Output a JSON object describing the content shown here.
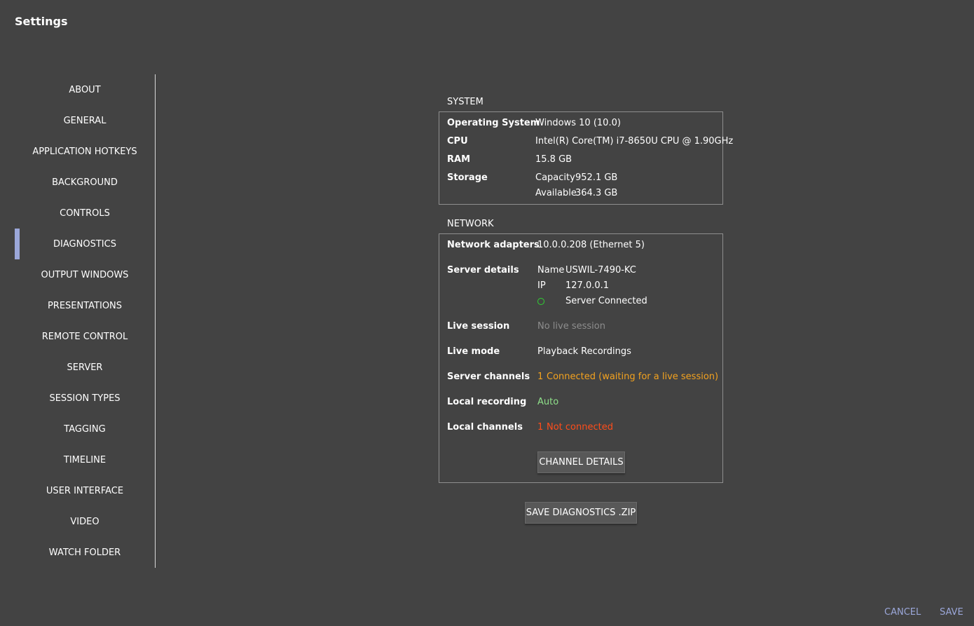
{
  "window": {
    "title": "Settings"
  },
  "sidebar": {
    "active_index": 5,
    "items": [
      {
        "label": "ABOUT"
      },
      {
        "label": "GENERAL"
      },
      {
        "label": "APPLICATION HOTKEYS"
      },
      {
        "label": "BACKGROUND"
      },
      {
        "label": "CONTROLS"
      },
      {
        "label": "DIAGNOSTICS"
      },
      {
        "label": "OUTPUT WINDOWS"
      },
      {
        "label": "PRESENTATIONS"
      },
      {
        "label": "REMOTE CONTROL"
      },
      {
        "label": "SERVER"
      },
      {
        "label": "SESSION TYPES"
      },
      {
        "label": "TAGGING"
      },
      {
        "label": "TIMELINE"
      },
      {
        "label": "USER INTERFACE"
      },
      {
        "label": "VIDEO"
      },
      {
        "label": "WATCH FOLDER"
      }
    ]
  },
  "system": {
    "heading": "SYSTEM",
    "os_label": "Operating System",
    "os_value": "Windows 10 (10.0)",
    "cpu_label": "CPU",
    "cpu_value": "Intel(R) Core(TM) i7-8650U CPU @ 1.90GHz",
    "ram_label": "RAM",
    "ram_value": "15.8 GB",
    "storage_label": "Storage",
    "capacity_label": "Capacity",
    "capacity_value": "952.1 GB",
    "available_label": "Available",
    "available_value": "364.3 GB"
  },
  "network": {
    "heading": "NETWORK",
    "adapters_label": "Network adapters",
    "adapters_value": "10.0.0.208 (Ethernet 5)",
    "server_details_label": "Server details",
    "name_label": "Name",
    "name_value": "USWIL-7490-KC",
    "ip_label": "IP",
    "ip_value": "127.0.0.1",
    "server_status": "Server Connected",
    "status_color": "#2fd232",
    "live_session_label": "Live session",
    "live_session_value": "No live session",
    "live_mode_label": "Live mode",
    "live_mode_value": "Playback Recordings",
    "server_channels_label": "Server channels",
    "server_channels_count": "1",
    "server_channels_value": "Connected (waiting for a live session)",
    "local_recording_label": "Local recording",
    "local_recording_value": "Auto",
    "local_channels_label": "Local channels",
    "local_channels_count": "1",
    "local_channels_value": "Not connected",
    "channel_details_button": "CHANNEL DETAILS"
  },
  "actions": {
    "save_diagnostics": "SAVE DIAGNOSTICS .ZIP",
    "cancel": "CANCEL",
    "save": "SAVE"
  },
  "colors": {
    "background": "#434343",
    "accent": "#9ba7d9",
    "warning": "#f3a21f",
    "ok": "#8fe08a",
    "error": "#ff4d1a"
  }
}
